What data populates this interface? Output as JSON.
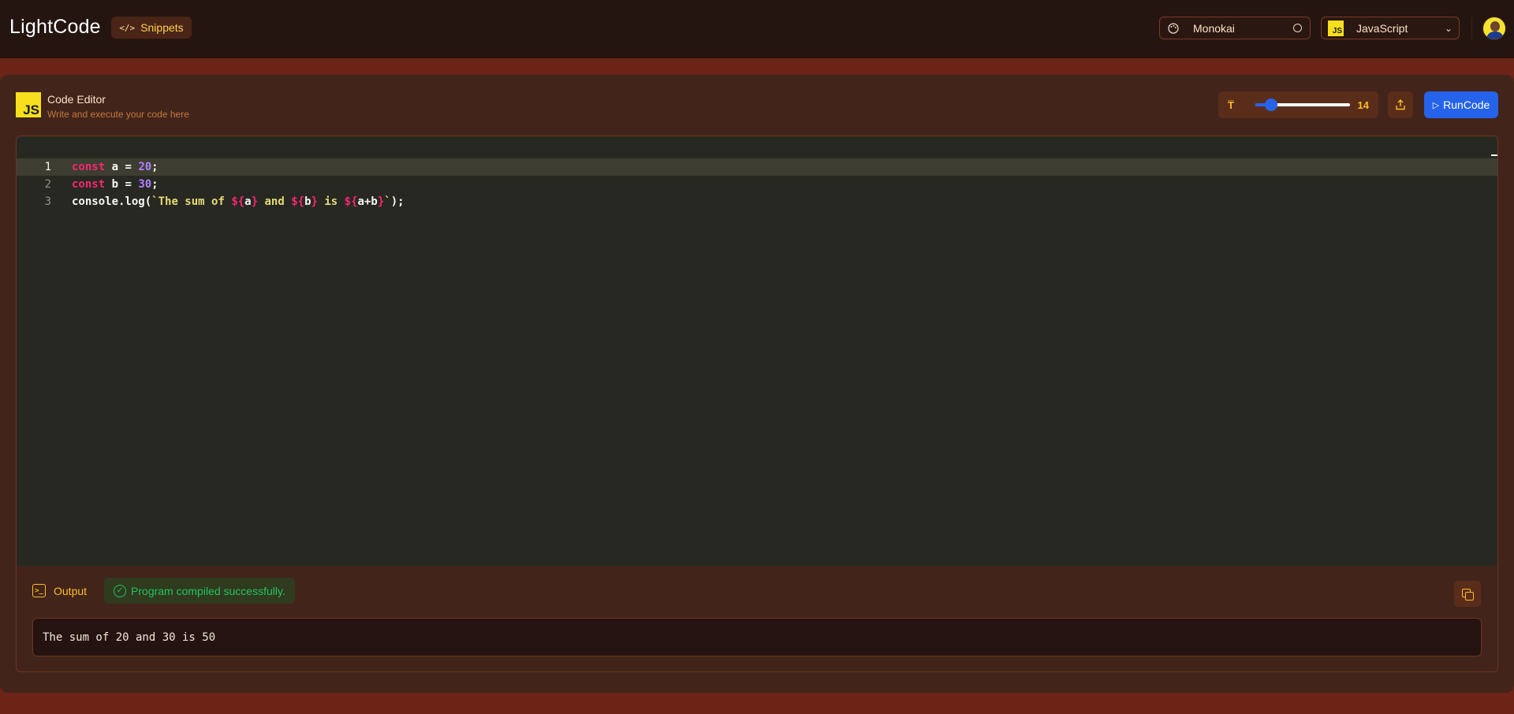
{
  "app": {
    "title": "LightCode",
    "snippets_label": "Snippets"
  },
  "header": {
    "theme": {
      "value": "Monokai",
      "icon": "palette-icon"
    },
    "language": {
      "value": "JavaScript",
      "badge": "JS",
      "icon": "chevron-down-icon"
    },
    "avatar": "user-avatar"
  },
  "editor": {
    "badge": "JS",
    "title": "Code Editor",
    "subtitle": "Write and execute your code here",
    "font_size": {
      "value": "14",
      "min": 12,
      "max": 24,
      "current": 14
    },
    "run_label": "RunCode",
    "active_line": 1,
    "lines": [
      {
        "number": "1",
        "tokens": [
          {
            "t": "const",
            "c": "kw"
          },
          {
            "t": " a = ",
            "c": "punc"
          },
          {
            "t": "20",
            "c": "num"
          },
          {
            "t": ";",
            "c": "punc"
          }
        ]
      },
      {
        "number": "2",
        "tokens": [
          {
            "t": "const",
            "c": "kw"
          },
          {
            "t": " b = ",
            "c": "punc"
          },
          {
            "t": "30",
            "c": "num"
          },
          {
            "t": ";",
            "c": "punc"
          }
        ]
      },
      {
        "number": "3",
        "tokens": [
          {
            "t": "console.log(",
            "c": "punc"
          },
          {
            "t": "`The sum of ",
            "c": "str"
          },
          {
            "t": "${",
            "c": "kw"
          },
          {
            "t": "a",
            "c": "punc"
          },
          {
            "t": "}",
            "c": "kw"
          },
          {
            "t": " and ",
            "c": "str"
          },
          {
            "t": "${",
            "c": "kw"
          },
          {
            "t": "b",
            "c": "punc"
          },
          {
            "t": "}",
            "c": "kw"
          },
          {
            "t": " is ",
            "c": "str"
          },
          {
            "t": "${",
            "c": "kw"
          },
          {
            "t": "a+b",
            "c": "punc"
          },
          {
            "t": "}",
            "c": "kw"
          },
          {
            "t": "`",
            "c": "str"
          },
          {
            "t": ");",
            "c": "punc"
          }
        ]
      }
    ]
  },
  "output": {
    "label": "Output",
    "status": "Program compiled successfully.",
    "text": "The sum of 20 and 30 is 50"
  },
  "colors": {
    "accent": "#fbbf24",
    "run_button": "#2563eb",
    "success": "#22c55e",
    "editor_bg": "#272822"
  }
}
